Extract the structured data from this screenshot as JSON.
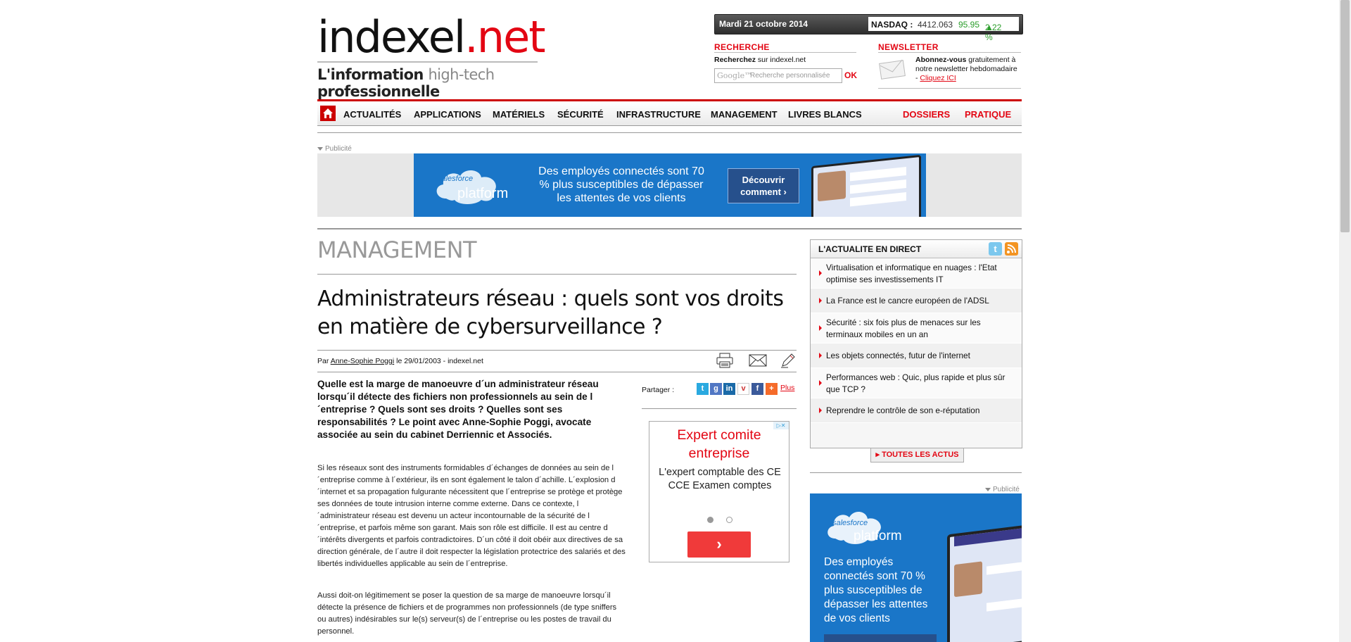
{
  "header": {
    "logo_word": "indexel",
    "logo_tld": ".net",
    "tagline_bold1": "L'information ",
    "tagline_grey": "high-tech",
    "tagline_bold2": " professionnelle"
  },
  "ticker": {
    "date": "Mardi 21 octobre 2014",
    "index_name": "NASDAQ :",
    "index_value": "4412.063",
    "change": "95.95",
    "change_pct": "2.22 %",
    "up_color": "#2a9d2a"
  },
  "search": {
    "heading": "RECHERCHE",
    "label_bold": "Recherchez",
    "label_rest": " sur indexel.net",
    "placeholder": "Recherche personnalisée",
    "submit": "OK"
  },
  "newsletter": {
    "heading": "NEWSLETTER",
    "text_bold": "Abonnez-vous",
    "text_rest": " gratuitement à notre newsletter hebdomadaire - ",
    "link": "Cliquez ICI"
  },
  "nav": {
    "items": [
      "ACTUALITÉS",
      "APPLICATIONS",
      "MATÉRIELS",
      "SÉCURITÉ",
      "INFRASTRUCTURE",
      "MANAGEMENT",
      "LIVRES BLANCS"
    ],
    "right_items": [
      "DOSSIERS",
      "PRATIQUE"
    ]
  },
  "ads": {
    "pub_label": "Publicité",
    "top_brand": "salesforce",
    "top_product": "platform",
    "top_text": "Des employés connectés sont 70 % plus susceptibles de dépasser les attentes de vos clients",
    "top_button": "Découvrir comment ›",
    "mid_headline": "Expert comite entreprise",
    "mid_sub": "L'expert comptable des CE CCE Examen comptes",
    "mid_go": "›",
    "side_text": "Des employés connectés sont 70 % plus susceptibles de dépasser les attentes de vos clients"
  },
  "article": {
    "section": "MANAGEMENT",
    "title": "Administrateurs réseau : quels sont vos droits en matière de cybersurveillance ?",
    "by_prefix": "Par ",
    "author": "Anne-Sophie Poggi",
    "by_suffix": " le 29/01/2003 - indexel.net",
    "share_label": "Partager :",
    "share_more": "Plus",
    "chapo": "Quelle est la marge de manoeuvre d´un administrateur réseau lorsqu´il détecte des fichiers non professionnels au sein de l´entreprise ? Quels sont ses droits ? Quelles sont ses responsabilités ? Le point avec Anne-Sophie Poggi, avocate associée au sein du cabinet Derriennic et Associés.",
    "p1": "Si les réseaux sont des instruments formidables d´échanges de données au sein de l´entreprise comme à l´extérieur, ils en sont également le talon d´achille. L´explosion d´internet et sa propagation fulgurante nécessitent que l´entreprise se protège et protège ses données de toute intrusion interne comme externe. Dans ce contexte, l´administrateur réseau est devenu un acteur incontournable de la sécurité de l´entreprise, et parfois même son garant. Mais son rôle est difficile. Il est au centre d´intérêts divergents et parfois contradictoires. D´un côté il doit obéir aux directives de sa direction générale, de l´autre il doit respecter la législation protectrice des salariés et des libertés individuelles applicable au sein de l´entreprise.",
    "p2": "Aussi doit-on légitimement se poser la question de sa marge de manoeuvre lorsqu´il détecte la présence de fichiers et de programmes non professionnels (de type sniffers ou autres) indésirables sur le(s) serveur(s) de l´entreprise ou les postes de travail du personnel."
  },
  "live": {
    "heading": "L'ACTUALITE EN DIRECT",
    "items": [
      "Virtualisation et informatique en nuages : l'Etat optimise ses investissements IT",
      "La France est le cancre européen de l'ADSL",
      "Sécurité : six fois plus de menaces sur les terminaux mobiles en un an",
      "Les objets connectés, futur de l'internet",
      "Performances web : Quic, plus rapide et plus sûr que TCP ?",
      "Reprendre le contrôle de son e-réputation"
    ],
    "all_link": "TOUTES LES ACTUS"
  }
}
